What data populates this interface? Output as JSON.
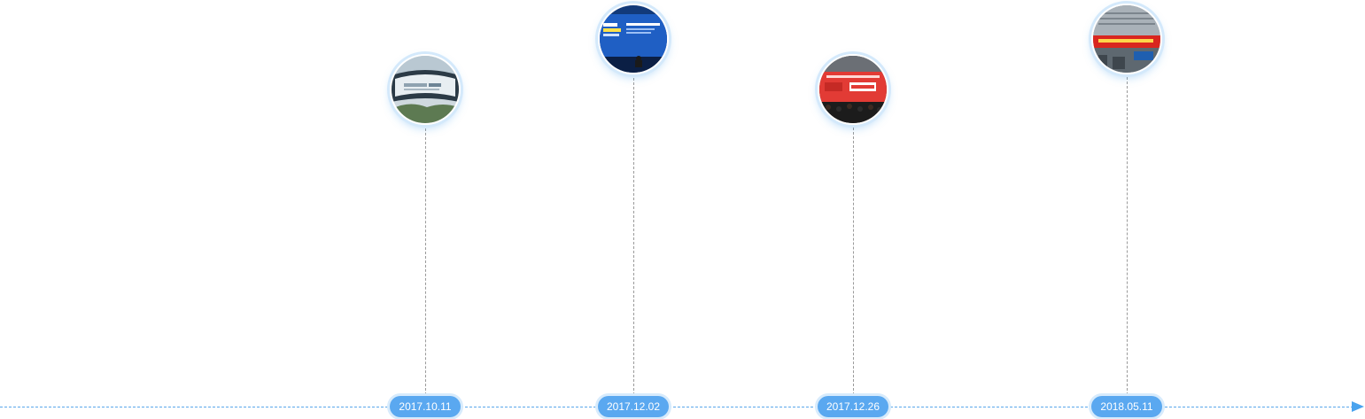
{
  "timeline": {
    "accent_color": "#5aa8f0",
    "axis_icon": "arrow-right-icon",
    "events": [
      {
        "date": "2017.10.11",
        "photo": "conference-exterior-photo"
      },
      {
        "date": "2017.12.02",
        "photo": "conference-stage-photo"
      },
      {
        "date": "2017.12.26",
        "photo": "opening-ceremony-photo"
      },
      {
        "date": "2018.05.11",
        "photo": "exhibition-hall-photo"
      }
    ]
  }
}
